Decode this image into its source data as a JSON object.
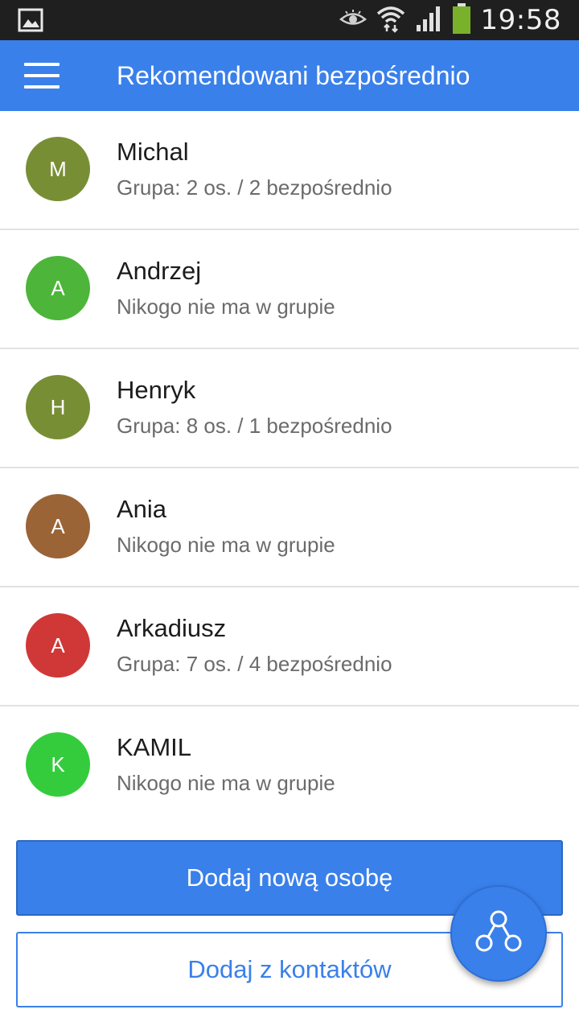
{
  "status_bar": {
    "time": "19:58",
    "icons": [
      "image-icon",
      "eye-icon",
      "wifi-icon",
      "signal-icon",
      "battery-icon"
    ]
  },
  "app_bar": {
    "title": "Rekomendowani bezpośrednio",
    "menu_icon": "hamburger-menu-icon"
  },
  "people": [
    {
      "initial": "M",
      "name": "Michal",
      "info": "Grupa: 2 os. / 2 bezpośrednio",
      "color": "#788e35"
    },
    {
      "initial": "A",
      "name": "Andrzej",
      "info": "Nikogo nie ma w grupie",
      "color": "#4db53a"
    },
    {
      "initial": "H",
      "name": "Henryk",
      "info": "Grupa: 8 os. / 1 bezpośrednio",
      "color": "#788e35"
    },
    {
      "initial": "A",
      "name": "Ania",
      "info": "Nikogo nie ma w grupie",
      "color": "#9a6437"
    },
    {
      "initial": "A",
      "name": "Arkadiusz",
      "info": "Grupa: 7 os. / 4 bezpośrednio",
      "color": "#cf3837"
    },
    {
      "initial": "K",
      "name": "KAMIL",
      "info": "Nikogo nie ma w grupie",
      "color": "#34cc3d"
    }
  ],
  "buttons": {
    "add_new": "Dodaj nową osobę",
    "add_from_contacts": "Dodaj z kontaktów"
  },
  "fab": {
    "icon": "network-tree-icon"
  },
  "colors": {
    "primary": "#3a80ea",
    "status_bar": "#1f1f1f"
  }
}
